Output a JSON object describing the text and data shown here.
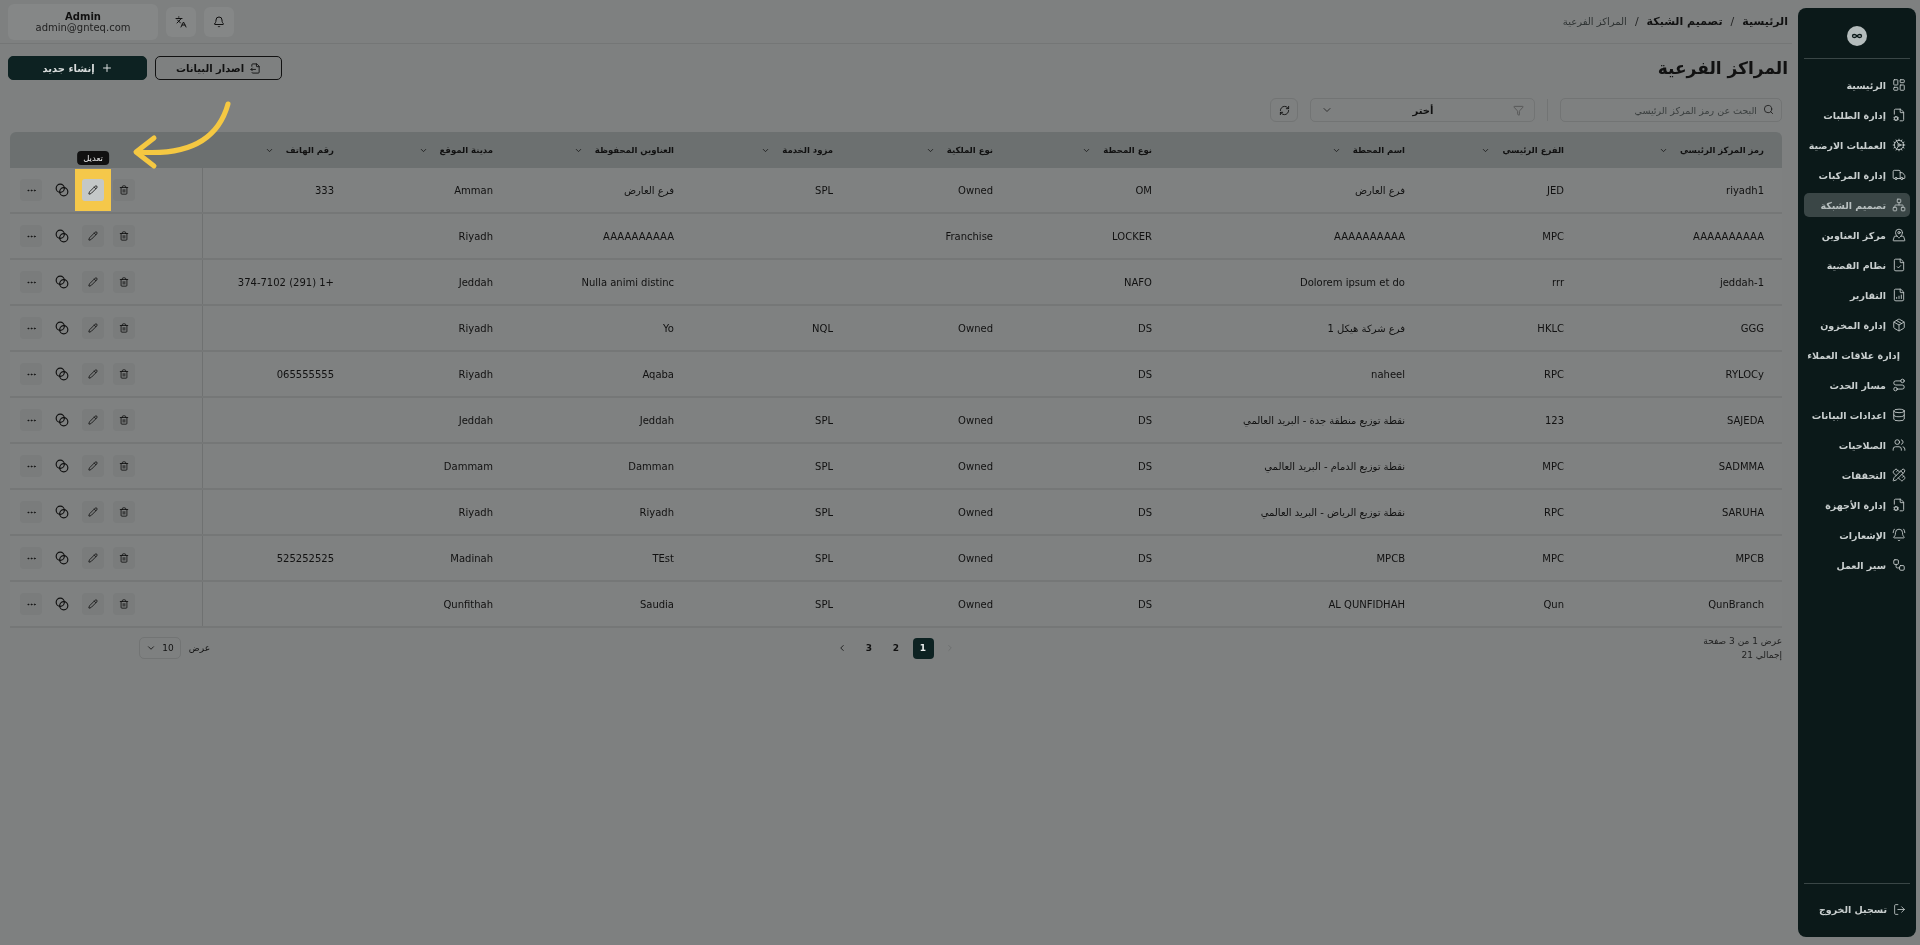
{
  "header": {
    "breadcrumbs": [
      {
        "label": "الرئيسية",
        "current": false
      },
      {
        "label": "تصميم الشبكة",
        "current": false
      },
      {
        "label": "المراكز الفرعية",
        "current": true
      }
    ],
    "separator": "/",
    "user": {
      "name": "Admin",
      "email": "admin@gnteq.com"
    }
  },
  "page": {
    "title": "المراكز الفرعية",
    "buttons": [
      {
        "label": "اصدار البيانات",
        "kind": "outline"
      },
      {
        "label": "إنشاء جديد",
        "kind": "primary"
      }
    ]
  },
  "filters": {
    "search": {
      "placeholder": "البحث عن رمز المركز الرئيسي"
    },
    "select": {
      "value": "أختر"
    }
  },
  "table": {
    "columns": [
      "رمز المركز الرئيسي",
      "الفرع الرئيسي",
      "اسم المحطة",
      "نوع المحطة",
      "نوع الملكية",
      "مزود الخدمة",
      "العناوين المحفوظة",
      "مدينة الموقع",
      "رقم الهاتف"
    ],
    "tooltip": "تعديل",
    "rows": [
      {
        "cells": [
          "riyadh1",
          "JED",
          "فرع العارض",
          "OM",
          "Owned",
          "SPL",
          "فرع العارض",
          "Amman",
          "333"
        ],
        "edit_highlighted": true
      },
      {
        "cells": [
          "AAAAAAAAAA",
          "MPC",
          "AAAAAAAAAA",
          "LOCKER",
          "Franchise",
          "",
          "AAAAAAAAAA",
          "Riyadh",
          ""
        ],
        "edit_highlighted": false
      },
      {
        "cells": [
          "jeddah-1",
          "rrr",
          "Dolorem ipsum et do",
          "NAFO",
          "",
          "",
          "Nulla animi distinc",
          "Jeddah",
          "+1 (291) 374-7102"
        ],
        "edit_highlighted": false
      },
      {
        "cells": [
          "GGG",
          "HKLC",
          "فرع شركة هيكل 1",
          "DS",
          "Owned",
          "NQL",
          "Yo",
          "Riyadh",
          ""
        ],
        "edit_highlighted": false
      },
      {
        "cells": [
          "RYLOCy",
          "RPC",
          "naheel",
          "DS",
          "",
          "",
          "Aqaba",
          "Riyadh",
          "065555555"
        ],
        "edit_highlighted": false
      },
      {
        "cells": [
          "SAJEDA",
          "123",
          "نقطة توزيع منطقة جدة - البريد العالمي",
          "DS",
          "Owned",
          "SPL",
          "Jeddah",
          "Jeddah",
          ""
        ],
        "edit_highlighted": false
      },
      {
        "cells": [
          "SADMMA",
          "MPC",
          "نقطة توزيع الدمام - البريد العالمي",
          "DS",
          "Owned",
          "SPL",
          "Damman",
          "Dammam",
          ""
        ],
        "edit_highlighted": false
      },
      {
        "cells": [
          "SARUHA",
          "RPC",
          "نقطة توزيع الرياض - البريد العالمي",
          "DS",
          "Owned",
          "SPL",
          "Riyadh",
          "Riyadh",
          ""
        ],
        "edit_highlighted": false
      },
      {
        "cells": [
          "MPCB",
          "MPC",
          "MPCB",
          "DS",
          "Owned",
          "SPL",
          "TEst",
          "Madinah",
          "525252525"
        ],
        "edit_highlighted": false
      },
      {
        "cells": [
          "QunBranch",
          "Qun",
          "AL QUNFIDHAH",
          "DS",
          "Owned",
          "SPL",
          "Saudia",
          "Qunfithah",
          ""
        ],
        "edit_highlighted": false
      }
    ]
  },
  "pagination": {
    "summary": "عرض 1 من 3 صفحة",
    "total": "إجمالي 21",
    "prev": {
      "disabled": true
    },
    "next": {
      "disabled": false
    },
    "pages": [
      {
        "label": "1",
        "selected": true
      },
      {
        "label": "2",
        "selected": false
      },
      {
        "label": "3",
        "selected": false
      }
    ],
    "size_label": "عرض",
    "page_size": "10"
  },
  "sidebar": {
    "items": [
      {
        "label": "الرئيسية",
        "selected": false
      },
      {
        "label": "إدارة الطلبات",
        "selected": false
      },
      {
        "label": "العمليات الارضية",
        "selected": false
      },
      {
        "label": "إدارة المركبات",
        "selected": false
      },
      {
        "label": "تصميم الشبكة",
        "selected": true
      },
      {
        "label": "مركز العناوين",
        "selected": false
      },
      {
        "label": "نظام القضية",
        "selected": false
      },
      {
        "label": "التقارير",
        "selected": false
      },
      {
        "label": "إدارة المخزون",
        "selected": false
      },
      {
        "label": "إدارة علاقات العملاء",
        "selected": false
      },
      {
        "label": "مسار الحدث",
        "selected": false
      },
      {
        "label": "اعدادات البيانات",
        "selected": false
      },
      {
        "label": "الصلاحيات",
        "selected": false
      },
      {
        "label": "التحققات",
        "selected": false
      },
      {
        "label": "إدارة الأجهزة",
        "selected": false
      },
      {
        "label": "الإشعارات",
        "selected": false
      },
      {
        "label": "سير العمل",
        "selected": false
      }
    ],
    "logout": "تسجيل الخروج"
  }
}
